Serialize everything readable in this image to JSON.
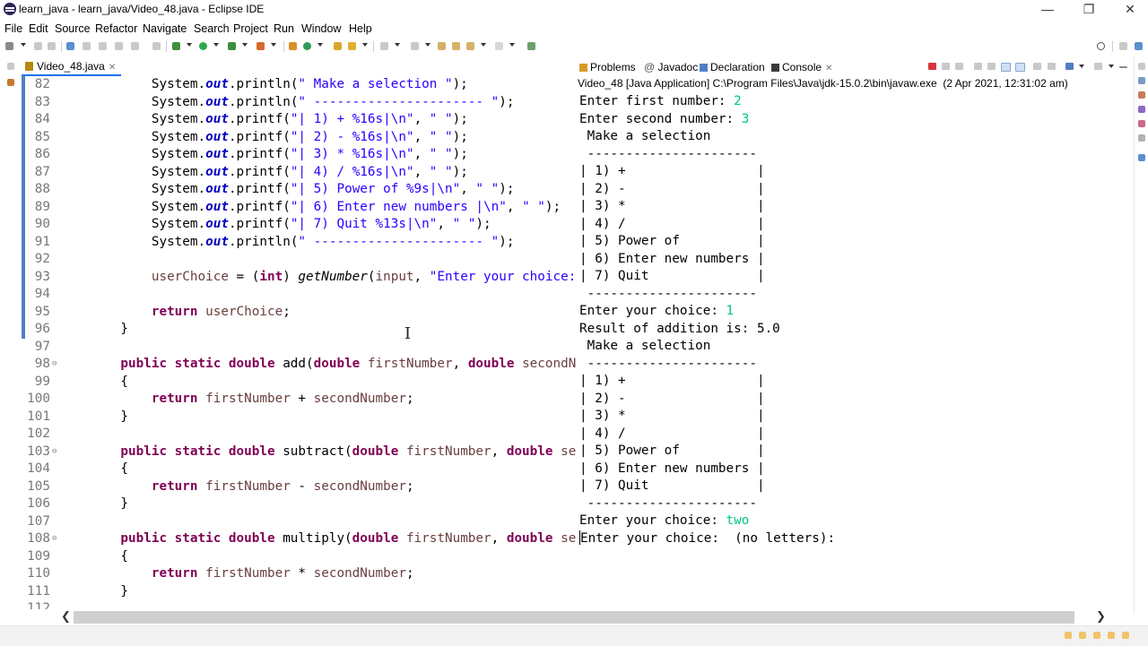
{
  "window": {
    "title": "learn_java - learn_java/Video_48.java - Eclipse IDE",
    "minimize_icon": "—",
    "restore_icon": "❐",
    "close_icon": "✕"
  },
  "menu": [
    "File",
    "Edit",
    "Source",
    "Refactor",
    "Navigate",
    "Search",
    "Project",
    "Run",
    "Window",
    "Help"
  ],
  "editor": {
    "tab": "Video_48.java",
    "tab_close": "✕",
    "lines": [
      {
        "n": "82",
        "fold": "",
        "segs": [
          [
            "",
            "        System."
          ],
          [
            "fld",
            "out"
          ],
          [
            "",
            ".println("
          ],
          [
            "str",
            "\" Make a selection \""
          ],
          [
            "",
            ");"
          ]
        ]
      },
      {
        "n": "83",
        "fold": "",
        "segs": [
          [
            "",
            "        System."
          ],
          [
            "fld",
            "out"
          ],
          [
            "",
            ".println("
          ],
          [
            "str",
            "\" ---------------------- \""
          ],
          [
            "",
            ");"
          ]
        ]
      },
      {
        "n": "84",
        "fold": "",
        "segs": [
          [
            "",
            "        System."
          ],
          [
            "fld",
            "out"
          ],
          [
            "",
            ".printf("
          ],
          [
            "str",
            "\"| 1) + %16s|\\n\""
          ],
          [
            "",
            ", "
          ],
          [
            "str",
            "\" \""
          ],
          [
            "",
            ");"
          ]
        ]
      },
      {
        "n": "85",
        "fold": "",
        "segs": [
          [
            "",
            "        System."
          ],
          [
            "fld",
            "out"
          ],
          [
            "",
            ".printf("
          ],
          [
            "str",
            "\"| 2) - %16s|\\n\""
          ],
          [
            "",
            ", "
          ],
          [
            "str",
            "\" \""
          ],
          [
            "",
            ");"
          ]
        ]
      },
      {
        "n": "86",
        "fold": "",
        "segs": [
          [
            "",
            "        System."
          ],
          [
            "fld",
            "out"
          ],
          [
            "",
            ".printf("
          ],
          [
            "str",
            "\"| 3) * %16s|\\n\""
          ],
          [
            "",
            ", "
          ],
          [
            "str",
            "\" \""
          ],
          [
            "",
            ");"
          ]
        ]
      },
      {
        "n": "87",
        "fold": "",
        "segs": [
          [
            "",
            "        System."
          ],
          [
            "fld",
            "out"
          ],
          [
            "",
            ".printf("
          ],
          [
            "str",
            "\"| 4) / %16s|\\n\""
          ],
          [
            "",
            ", "
          ],
          [
            "str",
            "\" \""
          ],
          [
            "",
            ");"
          ]
        ]
      },
      {
        "n": "88",
        "fold": "",
        "segs": [
          [
            "",
            "        System."
          ],
          [
            "fld",
            "out"
          ],
          [
            "",
            ".printf("
          ],
          [
            "str",
            "\"| 5) Power of %9s|\\n\""
          ],
          [
            "",
            ", "
          ],
          [
            "str",
            "\" \""
          ],
          [
            "",
            ");"
          ]
        ]
      },
      {
        "n": "89",
        "fold": "",
        "segs": [
          [
            "",
            "        System."
          ],
          [
            "fld",
            "out"
          ],
          [
            "",
            ".printf("
          ],
          [
            "str",
            "\"| 6) Enter new numbers |\\n\""
          ],
          [
            "",
            ", "
          ],
          [
            "str",
            "\" \""
          ],
          [
            "",
            ");"
          ]
        ]
      },
      {
        "n": "90",
        "fold": "",
        "segs": [
          [
            "",
            "        System."
          ],
          [
            "fld",
            "out"
          ],
          [
            "",
            ".printf("
          ],
          [
            "str",
            "\"| 7) Quit %13s|\\n\""
          ],
          [
            "",
            ", "
          ],
          [
            "str",
            "\" \""
          ],
          [
            "",
            ");"
          ]
        ]
      },
      {
        "n": "91",
        "fold": "",
        "segs": [
          [
            "",
            "        System."
          ],
          [
            "fld",
            "out"
          ],
          [
            "",
            ".println("
          ],
          [
            "str",
            "\" ---------------------- \""
          ],
          [
            "",
            ");"
          ]
        ]
      },
      {
        "n": "92",
        "fold": "",
        "segs": []
      },
      {
        "n": "93",
        "fold": "",
        "segs": [
          [
            "var",
            "        userChoice"
          ],
          [
            "",
            " = ("
          ],
          [
            "kw",
            "int"
          ],
          [
            "",
            ") "
          ],
          [
            "mth",
            "getNumber"
          ],
          [
            "",
            "("
          ],
          [
            "var",
            "input"
          ],
          [
            "",
            ", "
          ],
          [
            "str",
            "\"Enter your choice: \""
          ],
          [
            "",
            ")"
          ]
        ]
      },
      {
        "n": "94",
        "fold": "",
        "segs": []
      },
      {
        "n": "95",
        "fold": "",
        "segs": [
          [
            "kw",
            "        return"
          ],
          [
            "",
            " "
          ],
          [
            "var",
            "userChoice"
          ],
          [
            "",
            ";"
          ]
        ]
      },
      {
        "n": "96",
        "fold": "",
        "segs": [
          [
            "",
            "    }"
          ]
        ]
      },
      {
        "n": "97",
        "fold": "",
        "segs": []
      },
      {
        "n": "98",
        "fold": "⊖",
        "segs": [
          [
            "kw",
            "    public static double"
          ],
          [
            "",
            " add("
          ],
          [
            "kw",
            "double"
          ],
          [
            "",
            " "
          ],
          [
            "var",
            "firstNumber"
          ],
          [
            "",
            ", "
          ],
          [
            "kw",
            "double"
          ],
          [
            "",
            " "
          ],
          [
            "var",
            "secondNumb"
          ]
        ]
      },
      {
        "n": "99",
        "fold": "",
        "segs": [
          [
            "",
            "    {"
          ]
        ]
      },
      {
        "n": "100",
        "fold": "",
        "segs": [
          [
            "kw",
            "        return"
          ],
          [
            "",
            " "
          ],
          [
            "var",
            "firstNumber"
          ],
          [
            "",
            " + "
          ],
          [
            "var",
            "secondNumber"
          ],
          [
            "",
            ";"
          ]
        ]
      },
      {
        "n": "101",
        "fold": "",
        "segs": [
          [
            "",
            "    }"
          ]
        ]
      },
      {
        "n": "102",
        "fold": "",
        "segs": []
      },
      {
        "n": "103",
        "fold": "⊖",
        "segs": [
          [
            "kw",
            "    public static double"
          ],
          [
            "",
            " subtract("
          ],
          [
            "kw",
            "double"
          ],
          [
            "",
            " "
          ],
          [
            "var",
            "firstNumber"
          ],
          [
            "",
            ", "
          ],
          [
            "kw",
            "double"
          ],
          [
            "",
            " "
          ],
          [
            "var",
            "secon"
          ]
        ]
      },
      {
        "n": "104",
        "fold": "",
        "segs": [
          [
            "",
            "    {"
          ]
        ]
      },
      {
        "n": "105",
        "fold": "",
        "segs": [
          [
            "kw",
            "        return"
          ],
          [
            "",
            " "
          ],
          [
            "var",
            "firstNumber"
          ],
          [
            "",
            " - "
          ],
          [
            "var",
            "secondNumber"
          ],
          [
            "",
            ";"
          ]
        ]
      },
      {
        "n": "106",
        "fold": "",
        "segs": [
          [
            "",
            "    }"
          ]
        ]
      },
      {
        "n": "107",
        "fold": "",
        "segs": []
      },
      {
        "n": "108",
        "fold": "⊖",
        "segs": [
          [
            "kw",
            "    public static double"
          ],
          [
            "",
            " multiply("
          ],
          [
            "kw",
            "double"
          ],
          [
            "",
            " "
          ],
          [
            "var",
            "firstNumber"
          ],
          [
            "",
            ", "
          ],
          [
            "kw",
            "double"
          ],
          [
            "",
            " "
          ],
          [
            "var",
            "secon"
          ]
        ]
      },
      {
        "n": "109",
        "fold": "",
        "segs": [
          [
            "",
            "    {"
          ]
        ]
      },
      {
        "n": "110",
        "fold": "",
        "segs": [
          [
            "kw",
            "        return"
          ],
          [
            "",
            " "
          ],
          [
            "var",
            "firstNumber"
          ],
          [
            "",
            " * "
          ],
          [
            "var",
            "secondNumber"
          ],
          [
            "",
            ";"
          ]
        ]
      },
      {
        "n": "111",
        "fold": "",
        "segs": [
          [
            "",
            "    }"
          ]
        ]
      },
      {
        "n": "112",
        "fold": "",
        "segs": []
      }
    ]
  },
  "views": {
    "problems": "Problems",
    "javadoc": "Javadoc",
    "declaration": "Declaration",
    "console": "Console",
    "console_close": "✕"
  },
  "console": {
    "header": "Video_48 [Java Application] C:\\Program Files\\Java\\jdk-15.0.2\\bin\\javaw.exe  (2 Apr 2021, 12:31:02 am)",
    "lines": [
      {
        "text": "Enter first number: ",
        "input": "2"
      },
      {
        "text": "Enter second number: ",
        "input": "3"
      },
      {
        "text": " Make a selection ",
        "input": ""
      },
      {
        "text": " ---------------------- ",
        "input": ""
      },
      {
        "text": "| 1) +                 |",
        "input": ""
      },
      {
        "text": "| 2) -                 |",
        "input": ""
      },
      {
        "text": "| 3) *                 |",
        "input": ""
      },
      {
        "text": "| 4) /                 |",
        "input": ""
      },
      {
        "text": "| 5) Power of          |",
        "input": ""
      },
      {
        "text": "| 6) Enter new numbers |",
        "input": ""
      },
      {
        "text": "| 7) Quit              |",
        "input": ""
      },
      {
        "text": " ---------------------- ",
        "input": ""
      },
      {
        "text": "Enter your choice: ",
        "input": "1"
      },
      {
        "text": "Result of addition is: 5.0",
        "input": ""
      },
      {
        "text": " Make a selection ",
        "input": ""
      },
      {
        "text": " ---------------------- ",
        "input": ""
      },
      {
        "text": "| 1) +                 |",
        "input": ""
      },
      {
        "text": "| 2) -                 |",
        "input": ""
      },
      {
        "text": "| 3) *                 |",
        "input": ""
      },
      {
        "text": "| 4) /                 |",
        "input": ""
      },
      {
        "text": "| 5) Power of          |",
        "input": ""
      },
      {
        "text": "| 6) Enter new numbers |",
        "input": ""
      },
      {
        "text": "| 7) Quit              |",
        "input": ""
      },
      {
        "text": " ---------------------- ",
        "input": ""
      },
      {
        "text": "Enter your choice: ",
        "input": "two"
      },
      {
        "text": "Enter your choice:  (no letters):",
        "input": ""
      }
    ]
  },
  "scroll": {
    "left_arrow": "❮",
    "right_arrow": "❯"
  },
  "colors": {
    "keyword": "#7f0055",
    "field": "#0000c0",
    "string": "#2a00ff",
    "variable": "#6a3e3e",
    "console_input": "#00c87d",
    "line_number": "#787878",
    "change_bar": "#4f7fc4"
  }
}
